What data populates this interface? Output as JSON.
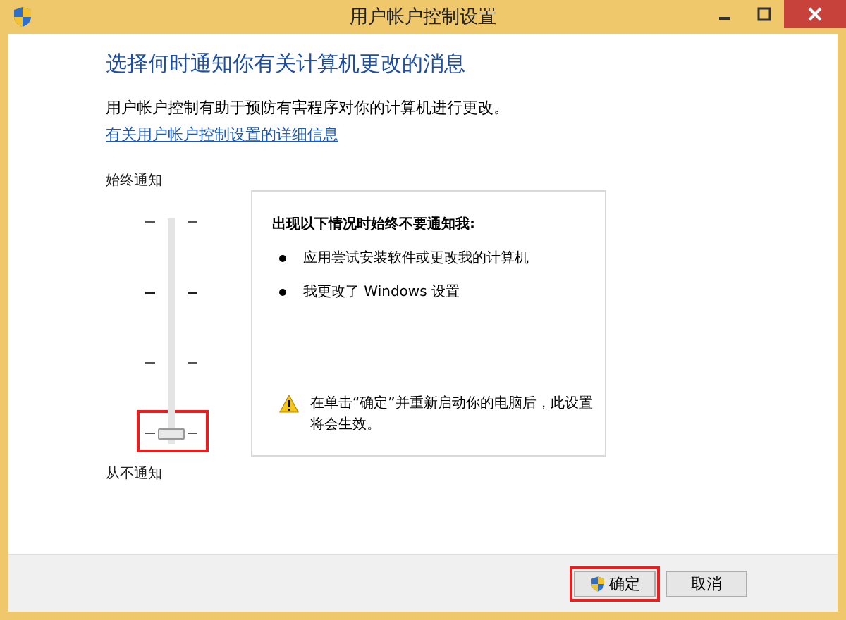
{
  "window": {
    "title": "用户帐户控制设置"
  },
  "heading": "选择何时通知你有关计算机更改的消息",
  "description": "用户帐户控制有助于预防有害程序对你的计算机进行更改。",
  "link": "有关用户帐户控制设置的详细信息",
  "slider": {
    "top_label": "始终通知",
    "bottom_label": "从不通知",
    "level": 0,
    "highlighted": true
  },
  "info_box": {
    "title": "出现以下情况时始终不要通知我:",
    "items": [
      "应用尝试安装软件或更改我的计算机",
      "我更改了 Windows 设置"
    ],
    "warning": "在单击“确定”并重新启动你的电脑后，此设置将会生效。"
  },
  "buttons": [
    {
      "label": "确定",
      "kind": "shield",
      "highlighted": true
    },
    {
      "label": "取消",
      "kind": "plain",
      "highlighted": false
    }
  ]
}
